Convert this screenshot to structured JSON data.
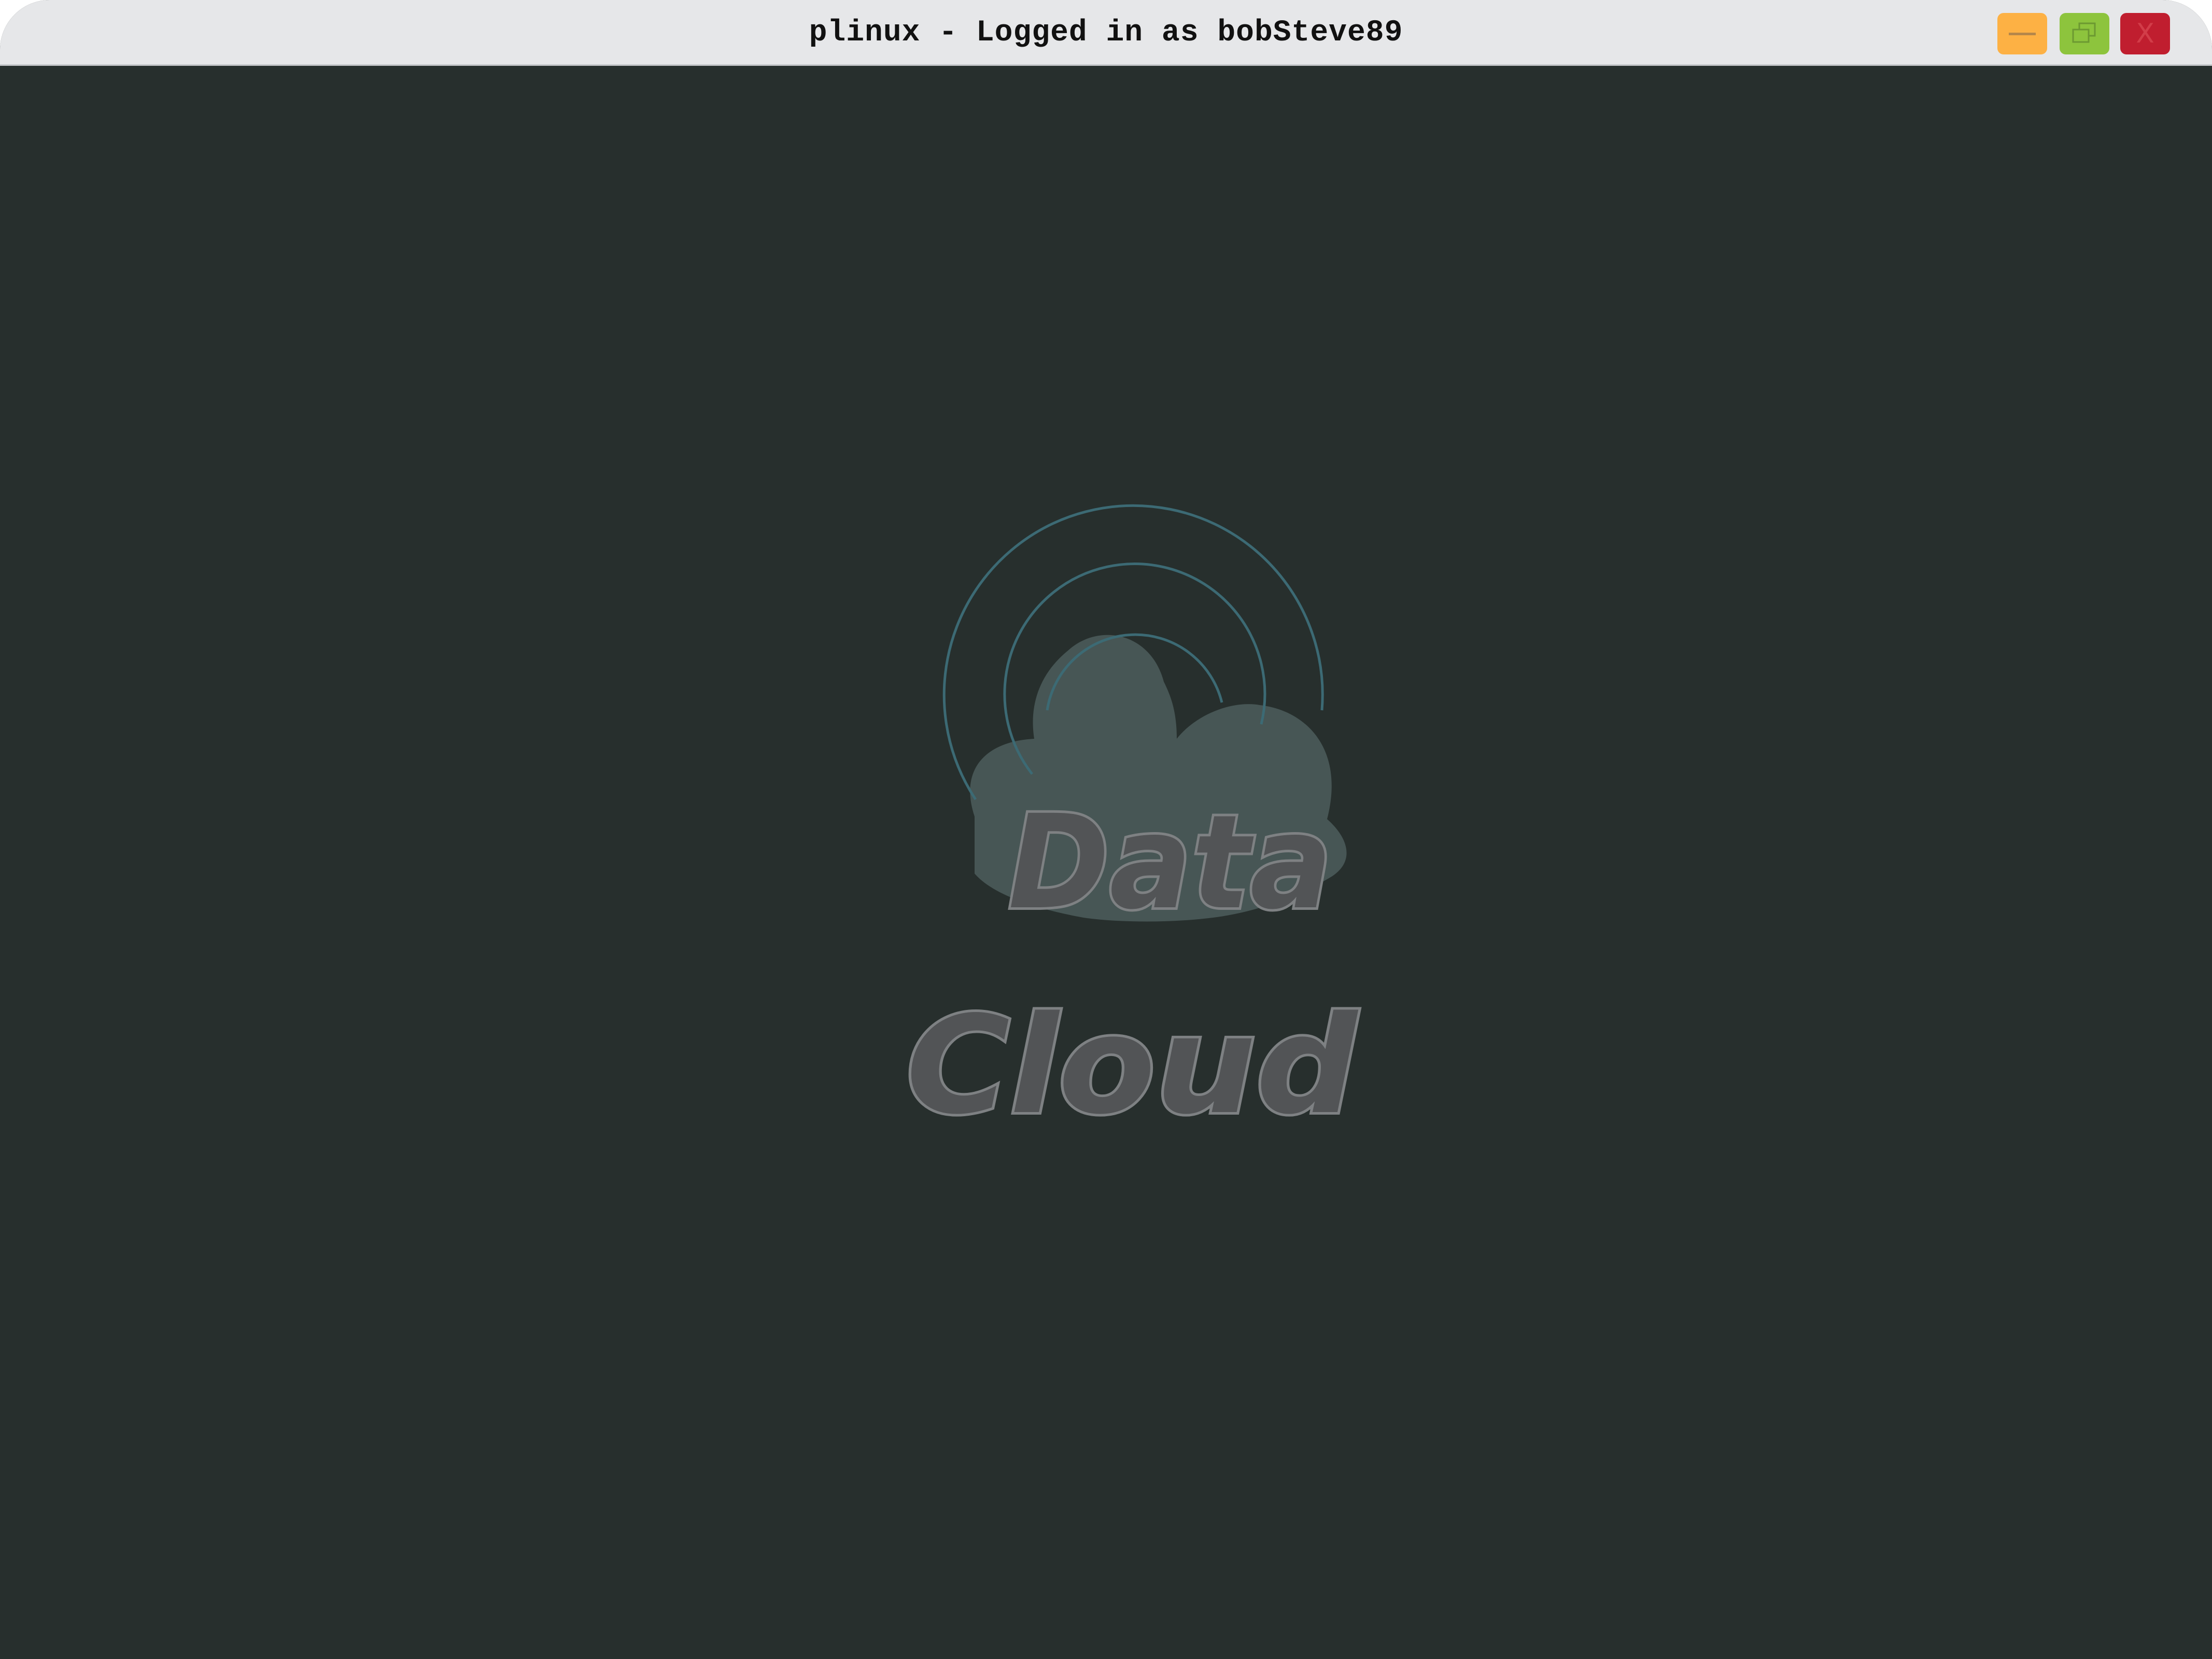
{
  "window": {
    "title": "plinux - Logged in as bobSteve89",
    "controls": {
      "minimize_icon": "minimize-icon",
      "maximize_icon": "restore-icon",
      "close_label": "X"
    },
    "colors": {
      "titlebar": "#e6e7e9",
      "background": "#272f2d",
      "minimize": "#fdb144",
      "maximize": "#8dc43d",
      "close": "#c01e2f"
    }
  },
  "logo": {
    "line1": "Data",
    "line2": "Cloud",
    "icon": "cloud-signal-icon",
    "colors": {
      "cloud": "#475655",
      "signal": "#3c6a74",
      "text_fill": "#525456",
      "text_outline": "#7e8183"
    }
  }
}
